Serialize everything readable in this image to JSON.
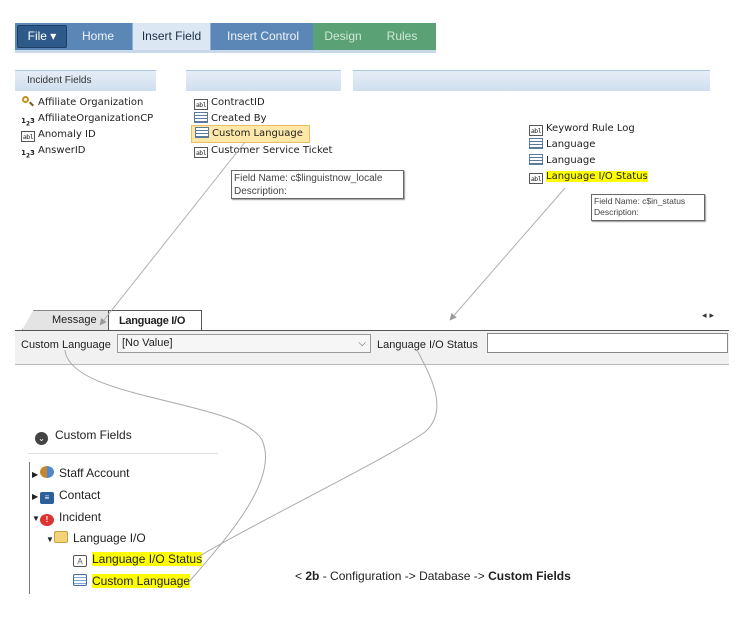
{
  "ribbon": {
    "file": "File ▾",
    "tabs": [
      "Home",
      "Insert Field",
      "Insert Control",
      "Design",
      "Rules"
    ],
    "active_tab": "Insert Field"
  },
  "panels": {
    "incident_header": "Incident Fields",
    "col1": [
      "Affiliate Organization",
      "AffiliateOrganizationCP",
      "Anomaly ID",
      "AnswerID"
    ],
    "col2": [
      "ContractID",
      "Created By",
      "Custom Language",
      "Customer Service Ticket"
    ],
    "col3": [
      "Keyword Rule Log",
      "Language",
      "Language",
      "Language I/O Status"
    ]
  },
  "tooltips": {
    "t1_line1": "Field Name:  c$linguistnow_locale",
    "t1_line2": "Description:",
    "t2_line1": "Field Name:  c$in_status",
    "t2_line2": "Description:"
  },
  "form": {
    "tabs": [
      "Message",
      "Language I/O"
    ],
    "active_tab": "Language I/O",
    "custom_language_label": "Custom Language",
    "dropdown_value": "[No Value]",
    "status_label": "Language I/O Status",
    "status_value": ""
  },
  "custom_fields": {
    "title": "Custom Fields",
    "tree": [
      "Staff Account",
      "Contact",
      "Incident",
      "Language I/O",
      "Language I/O Status",
      "Custom Language"
    ]
  },
  "caption": {
    "prefix": "< ",
    "step": "2b",
    "mid": " - Configuration -> Database -> ",
    "end": "Custom Fields"
  },
  "colors": {
    "highlight": "#ffff00",
    "ribbon": "#5b87b6",
    "selected": "#fde8a9"
  },
  "icons": [
    "magnifier-icon",
    "number-icon",
    "text-field-icon",
    "menu-field-icon",
    "folder-icon",
    "staff-icon",
    "contact-icon",
    "incident-icon"
  ]
}
